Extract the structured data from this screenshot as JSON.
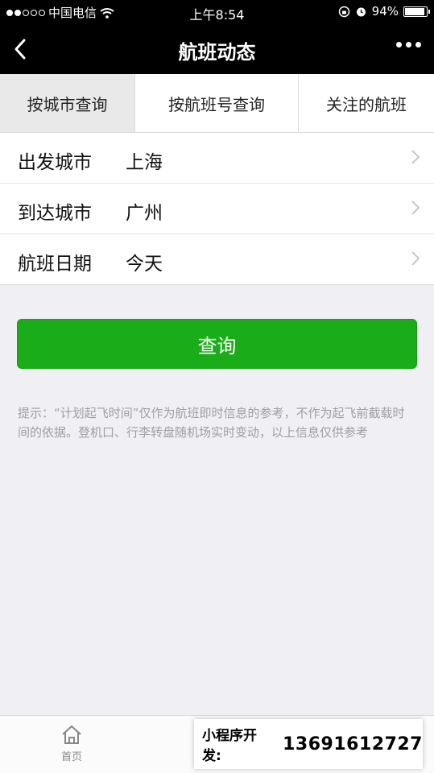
{
  "status_bar": {
    "carrier": "中国电信",
    "time": "上午8:54",
    "battery_percent": "94%",
    "battery_level": 0.94,
    "signal_strength": 2
  },
  "nav": {
    "title": "航班动态"
  },
  "tabs": [
    {
      "label": "按城市查询",
      "active": true
    },
    {
      "label": "按航班号查询",
      "active": false
    },
    {
      "label": "关注的航班",
      "active": false
    }
  ],
  "form": {
    "rows": [
      {
        "label": "出发城市",
        "value": "上海"
      },
      {
        "label": "到达城市",
        "value": "广州"
      },
      {
        "label": "航班日期",
        "value": "今天"
      }
    ]
  },
  "query_button": {
    "label": "查询"
  },
  "tip": {
    "text": "提示：“计划起飞时间”仅作为航班即时信息的参考，不作为起飞前截载时间的依据。登机口、行李转盘随机场实时变动，以上信息仅供参考"
  },
  "tabbar": {
    "home_label": "首页"
  },
  "promo": {
    "label": "小程序开发:",
    "phone": "13691612727"
  },
  "colors": {
    "accent_green": "#1aad19",
    "nav_background": "#000000",
    "page_background": "#efeff4"
  }
}
